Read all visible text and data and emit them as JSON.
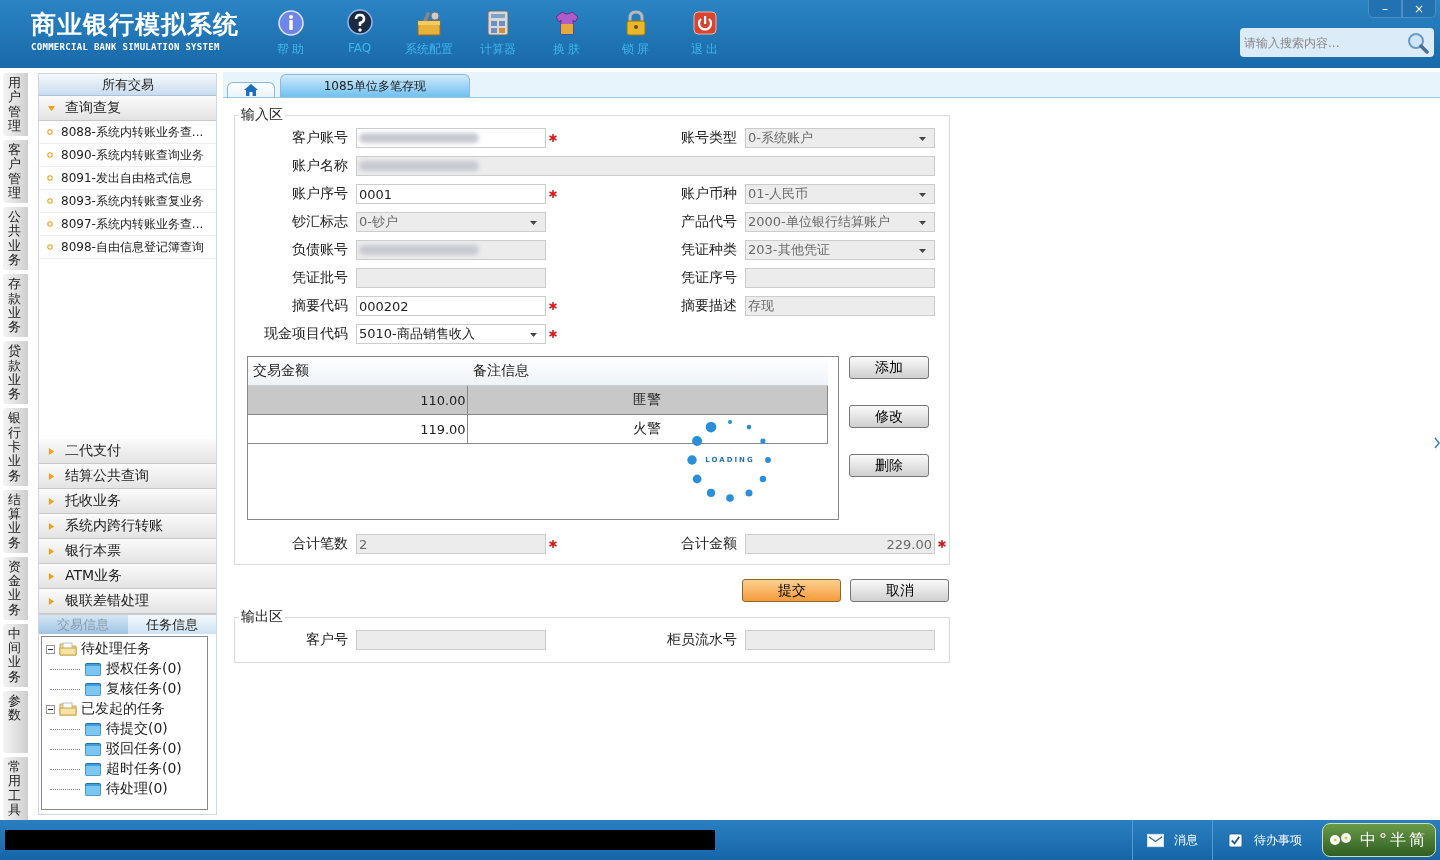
{
  "header": {
    "title": "商业银行模拟系统",
    "subtitle": "COMMERCIAL BANK SIMULATION SYSTEM",
    "tools": [
      {
        "kind": "info",
        "label": "帮 助"
      },
      {
        "kind": "faq",
        "label": "FAQ"
      },
      {
        "kind": "config",
        "label": "系统配置"
      },
      {
        "kind": "calculator",
        "label": "计算器"
      },
      {
        "kind": "skin",
        "label": "换 肤"
      },
      {
        "kind": "lock",
        "label": "锁 屏"
      },
      {
        "kind": "exit",
        "label": "退 出"
      }
    ],
    "window_buttons": [
      "–",
      "×"
    ],
    "search": {
      "placeholder": "请输入搜索内容..."
    }
  },
  "side_tabs": [
    "用户管理",
    "客户管理",
    "公共业务",
    "存款业务",
    "贷款业务",
    "银行卡业务",
    "结算业务",
    "资金业务",
    "中间业务",
    "参数",
    "常用工具"
  ],
  "sidebar": {
    "title": "所有交易",
    "groups": [
      {
        "label": "查询查复",
        "expanded": true,
        "items": [
          "8088-系统内转账业务查...",
          "8090-系统内转账查询业务",
          "8091-发出自由格式信息",
          "8093-系统内转账查复业务",
          "8097-系统内转账业务查...",
          "8098-自由信息登记簿查询"
        ]
      },
      {
        "label": "二代支付",
        "expanded": false
      },
      {
        "label": "结算公共查询",
        "expanded": false
      },
      {
        "label": "托收业务",
        "expanded": false
      },
      {
        "label": "系统内跨行转账",
        "expanded": false
      },
      {
        "label": "银行本票",
        "expanded": false
      },
      {
        "label": "ATM业务",
        "expanded": false
      },
      {
        "label": "银联差错处理",
        "expanded": false
      }
    ]
  },
  "task_panel": {
    "tabs": [
      {
        "label": "交易信息",
        "selected": false
      },
      {
        "label": "任务信息",
        "selected": true
      }
    ],
    "tree": [
      {
        "label": "待处理任务",
        "expanded": true,
        "children": [
          {
            "label": "授权任务(0)"
          },
          {
            "label": "复核任务(0)"
          }
        ]
      },
      {
        "label": "已发起的任务",
        "expanded": true,
        "children": [
          {
            "label": "待提交(0)"
          },
          {
            "label": "驳回任务(0)"
          },
          {
            "label": "超时任务(0)"
          },
          {
            "label": "待处理(0)"
          }
        ]
      }
    ]
  },
  "tabs": [
    {
      "kind": "home",
      "selected": false
    },
    {
      "kind": "page",
      "label": "1085单位多笔存现",
      "selected": true
    }
  ],
  "input_section": {
    "title": "输入区",
    "rows": [
      [
        {
          "label": "客户账号",
          "kind": "text",
          "blurred": true,
          "editable": true,
          "required": true
        },
        {
          "label": "账号类型",
          "kind": "select",
          "value": "0-系统账户",
          "editable": false
        }
      ],
      [
        {
          "label": "账户名称",
          "kind": "wide",
          "blurred": true,
          "editable": false
        }
      ],
      [
        {
          "label": "账户序号",
          "kind": "text",
          "value": "0001",
          "editable": true,
          "required": true
        },
        {
          "label": "账户币种",
          "kind": "select",
          "value": "01-人民币",
          "editable": false
        }
      ],
      [
        {
          "label": "钞汇标志",
          "kind": "select",
          "value": "0-钞户",
          "editable": false
        },
        {
          "label": "产品代号",
          "kind": "select",
          "value": "2000-单位银行结算账户",
          "editable": false
        }
      ],
      [
        {
          "label": "负债账号",
          "kind": "text",
          "blurred": true,
          "editable": false
        },
        {
          "label": "凭证种类",
          "kind": "select",
          "value": "203-其他凭证",
          "editable": false
        }
      ],
      [
        {
          "label": "凭证批号",
          "kind": "text",
          "editable": false
        },
        {
          "label": "凭证序号",
          "kind": "text",
          "editable": false
        }
      ],
      [
        {
          "label": "摘要代码",
          "kind": "text",
          "value": "000202",
          "editable": true,
          "required": true
        },
        {
          "label": "摘要描述",
          "kind": "text",
          "value": "存现",
          "editable": false
        }
      ],
      [
        {
          "label": "现金项目代码",
          "kind": "select",
          "value": "5010-商品销售收入",
          "editable": true,
          "required": true
        }
      ]
    ],
    "grid": {
      "columns": [
        "交易金额",
        "备注信息"
      ],
      "rows": [
        {
          "amount": "110.00",
          "note": "匪警",
          "selected": true
        },
        {
          "amount": "119.00",
          "note": "火警",
          "selected": false
        }
      ]
    },
    "grid_buttons": [
      "添加",
      "修改",
      "删除"
    ],
    "loading": {
      "text": "LOADING"
    },
    "totals": [
      {
        "label": "合计笔数",
        "kind": "count",
        "value": "2",
        "required": true
      },
      {
        "label": "合计金额",
        "kind": "amount",
        "value": "229.00",
        "required": true
      }
    ]
  },
  "actions": [
    {
      "label": "提交",
      "primary": true
    },
    {
      "label": "取消",
      "primary": false
    }
  ],
  "output_section": {
    "title": "输出区",
    "fields": [
      {
        "label": "客户号"
      },
      {
        "label": "柜员流水号"
      }
    ]
  },
  "status_bar": {
    "redacted": true,
    "items": [
      {
        "kind": "message",
        "label": "消息"
      },
      {
        "kind": "todo",
        "label": "待办事项"
      }
    ],
    "ime": [
      "中",
      "°",
      "半",
      "简"
    ]
  }
}
